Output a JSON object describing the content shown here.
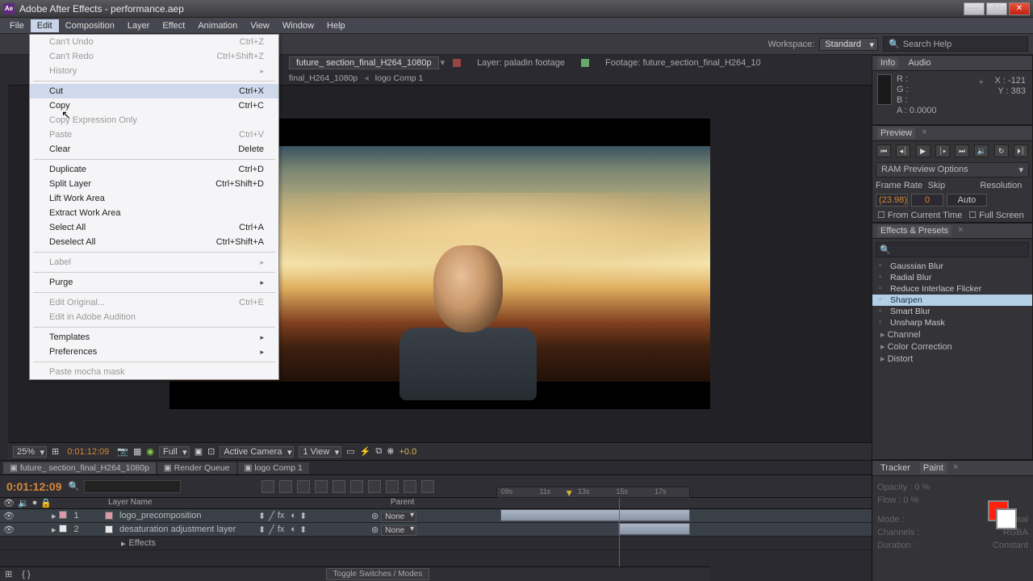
{
  "titlebar": {
    "app_icon_text": "Ae",
    "title": "Adobe After Effects - performance.aep"
  },
  "menubar": [
    "File",
    "Edit",
    "Composition",
    "Layer",
    "Effect",
    "Animation",
    "View",
    "Window",
    "Help"
  ],
  "active_menu_index": 1,
  "dropdown": [
    {
      "label": "Can't Undo",
      "shortcut": "Ctrl+Z",
      "disabled": true
    },
    {
      "label": "Can't Redo",
      "shortcut": "Ctrl+Shift+Z",
      "disabled": true
    },
    {
      "label": "History",
      "submenu": true,
      "disabled": true
    },
    {
      "sep": true
    },
    {
      "label": "Cut",
      "shortcut": "Ctrl+X",
      "highlight": true
    },
    {
      "label": "Copy",
      "shortcut": "Ctrl+C"
    },
    {
      "label": "Copy Expression Only",
      "disabled": true
    },
    {
      "label": "Paste",
      "shortcut": "Ctrl+V",
      "disabled": true
    },
    {
      "label": "Clear",
      "shortcut": "Delete"
    },
    {
      "sep": true
    },
    {
      "label": "Duplicate",
      "shortcut": "Ctrl+D"
    },
    {
      "label": "Split Layer",
      "shortcut": "Ctrl+Shift+D"
    },
    {
      "label": "Lift Work Area"
    },
    {
      "label": "Extract Work Area"
    },
    {
      "label": "Select All",
      "shortcut": "Ctrl+A"
    },
    {
      "label": "Deselect All",
      "shortcut": "Ctrl+Shift+A"
    },
    {
      "sep": true
    },
    {
      "label": "Label",
      "submenu": true,
      "disabled": true
    },
    {
      "sep": true
    },
    {
      "label": "Purge",
      "submenu": true
    },
    {
      "sep": true
    },
    {
      "label": "Edit Original...",
      "shortcut": "Ctrl+E",
      "disabled": true
    },
    {
      "label": "Edit in Adobe Audition",
      "disabled": true
    },
    {
      "sep": true
    },
    {
      "label": "Templates",
      "submenu": true
    },
    {
      "label": "Preferences",
      "submenu": true
    },
    {
      "sep": true
    },
    {
      "label": "Paste mocha mask",
      "disabled": true
    }
  ],
  "toolbar": {
    "workspace_label": "Workspace:",
    "workspace_value": "Standard",
    "search_placeholder": "Search Help"
  },
  "comp_tabs": {
    "main_tab": "future_ section_final_H264_1080p",
    "layer_info": "Layer: paladin footage",
    "footage_info": "Footage: future_section_final_H264_10",
    "crumb1": "final_H264_1080p",
    "crumb2": "logo Comp 1"
  },
  "info_panel": {
    "tabs": [
      "Info",
      "Audio"
    ],
    "r": "R :",
    "g": "G :",
    "b": "B :",
    "a_label": "A :",
    "a_val": "0.0000",
    "x_label": "X :",
    "x_val": "-121",
    "y_label": "Y :",
    "y_val": "383"
  },
  "preview_panel": {
    "title": "Preview",
    "ram_opts": "RAM Preview Options",
    "frame_rate_label": "Frame Rate",
    "skip_label": "Skip",
    "resolution_label": "Resolution",
    "frame_rate_val": "(23.98)",
    "skip_val": "0",
    "resolution_val": "Auto",
    "from_current": "From Current Time",
    "full_screen": "Full Screen"
  },
  "effects_panel": {
    "title": "Effects & Presets",
    "items": [
      "Gaussian Blur",
      "Radial Blur",
      "Reduce Interlace Flicker",
      "Sharpen",
      "Smart Blur",
      "Unsharp Mask"
    ],
    "selected_index": 3,
    "groups": [
      "Channel",
      "Color Correction",
      "Distort"
    ]
  },
  "tracker_panel": {
    "title": "Tracker"
  },
  "paint_panel": {
    "title": "Paint",
    "opacity": "Opacity : 0 %",
    "flow": "Flow : 0 %",
    "mode_label": "Mode :",
    "mode_val": "Normal",
    "channels_label": "Channels :",
    "channels_val": "RGBA",
    "duration_label": "Duration :",
    "duration_val": "Constant"
  },
  "viewer_bottom": {
    "zoom": "25%",
    "timecode": "0:01:12:09",
    "quality": "Full",
    "camera": "Active Camera",
    "views": "1 View",
    "exposure": "+0.0"
  },
  "timeline": {
    "tabs": [
      "future_ section_final_H264_1080p",
      "Render Queue",
      "logo Comp 1"
    ],
    "timecode": "0:01:12:09",
    "col_layer_name": "Layer Name",
    "col_parent": "Parent",
    "ruler_ticks": [
      {
        "label": "09s",
        "pct": 2
      },
      {
        "label": "11s",
        "pct": 22
      },
      {
        "label": "13s",
        "pct": 42
      },
      {
        "label": "15s",
        "pct": 62
      },
      {
        "label": "17s",
        "pct": 82
      }
    ],
    "layers": [
      {
        "idx": "1",
        "name": "logo_precomposition",
        "parent": "None",
        "selected": true,
        "pink": true
      },
      {
        "idx": "2",
        "name": "desaturation adjustment layer",
        "parent": "None",
        "selected": true,
        "pink": false
      }
    ],
    "effects_row": "Effects",
    "toggle_label": "Toggle Switches / Modes"
  }
}
